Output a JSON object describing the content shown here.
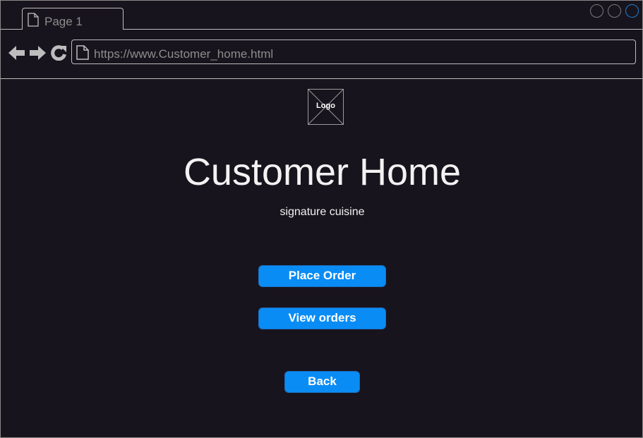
{
  "browser": {
    "tab_label": "Page 1",
    "address_url": "https://www.Customer_home.html",
    "icons": {
      "page": "page-icon",
      "back": "arrow-left-icon",
      "forward": "arrow-right-icon",
      "reload": "reload-icon"
    }
  },
  "main": {
    "logo_label": "Logo",
    "title": "Customer Home",
    "subtitle": "signature cuisine",
    "buttons": {
      "place_order": "Place Order",
      "view_orders": "View orders",
      "back": "Back"
    }
  },
  "colors": {
    "background": "#18141d",
    "button": "#0a8cf5",
    "window_control_active": "#1a7fd4"
  }
}
